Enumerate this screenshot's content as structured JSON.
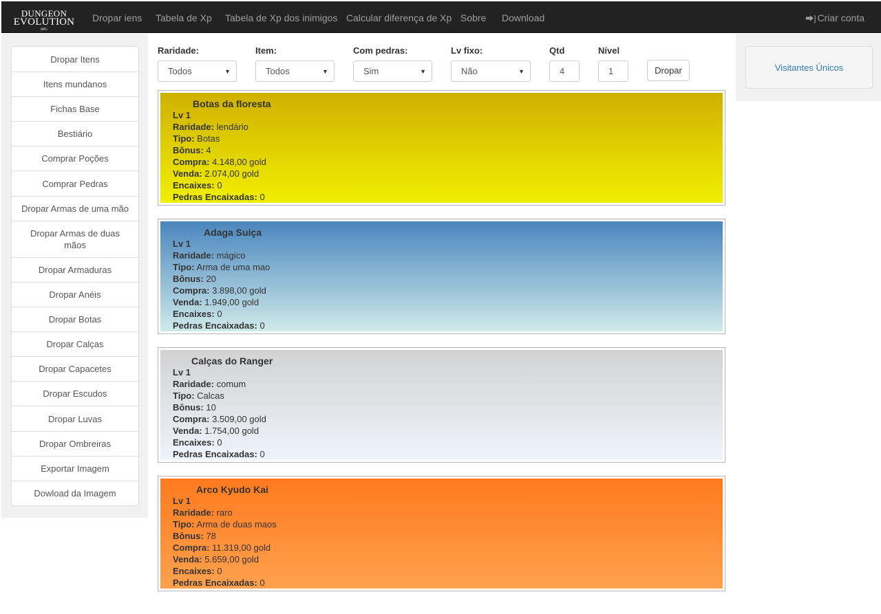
{
  "brand": {
    "line1": "Dungeon",
    "line2": "Evolution",
    "line3": "RPG"
  },
  "nav": {
    "links": [
      "Dropar iens",
      "Tabela de Xp",
      "Tabela de Xp dos inimigos",
      "Calcular diferença de Xp",
      "Sobre",
      "Download"
    ],
    "account_icon": "sign-in-icon",
    "account_label": "Criar conta"
  },
  "sidebar": {
    "items": [
      "Dropar Itens",
      "Itens mundanos",
      "Fichas Base",
      "Bestiário",
      "Comprar Poções",
      "Comprar Pedras",
      "Dropar Armas de uma mão",
      "Dropar Armas de duas mãos",
      "Dropar Armaduras",
      "Dropar Anéis",
      "Dropar Botas",
      "Dropar Calças",
      "Dropar Capacetes",
      "Dropar Escudos",
      "Dropar Luvas",
      "Dropar Ombreiras",
      "Exportar Imagem",
      "Dowload da Imagem"
    ]
  },
  "filters": {
    "raridade": {
      "label": "Raridade:",
      "value": "Todos"
    },
    "item": {
      "label": "Item:",
      "value": "Todos"
    },
    "pedras": {
      "label": "Com pedras:",
      "value": "Sim"
    },
    "lv_fixo": {
      "label": "Lv fixo:",
      "value": "Não"
    },
    "qtd": {
      "label": "Qtd",
      "value": "4"
    },
    "nivel": {
      "label": "Nível",
      "value": "1"
    },
    "drop_button": "Dropar"
  },
  "labels": {
    "raridade": "Raridade:",
    "tipo": "Tipo:",
    "bonus": "Bônus:",
    "compra": "Compra:",
    "venda": "Venda:",
    "encaixes": "Encaixes:",
    "pedras": "Pedras Encaixadas:"
  },
  "items": [
    {
      "name": "Botas da floresta",
      "lv": "Lv 1",
      "raridade": "lendário",
      "tipo": "Botas",
      "bonus": "4",
      "compra": "4.148,00 gold",
      "venda": "2.074,00 gold",
      "encaixes": "0",
      "pedras": "0"
    },
    {
      "name": "Adaga Suiça",
      "lv": "Lv 1",
      "raridade": "mágico",
      "tipo": "Arma de uma mao",
      "bonus": "20",
      "compra": "3.898,00 gold",
      "venda": "1.949,00 gold",
      "encaixes": "0",
      "pedras": "0"
    },
    {
      "name": "Calças do Ranger",
      "lv": "Lv 1",
      "raridade": "comum",
      "tipo": "Calcas",
      "bonus": "10",
      "compra": "3.509,00 gold",
      "venda": "1.754,00 gold",
      "encaixes": "0",
      "pedras": "0"
    },
    {
      "name": "Arco Kyudo Kai",
      "lv": "Lv 1",
      "raridade": "raro",
      "tipo": "Arma de duas maos",
      "bonus": "78",
      "compra": "11.319,00 gold",
      "venda": "5.659,00 gold",
      "encaixes": "0",
      "pedras": "0"
    }
  ],
  "right_panel": {
    "label": "Visitantes Únicos"
  }
}
